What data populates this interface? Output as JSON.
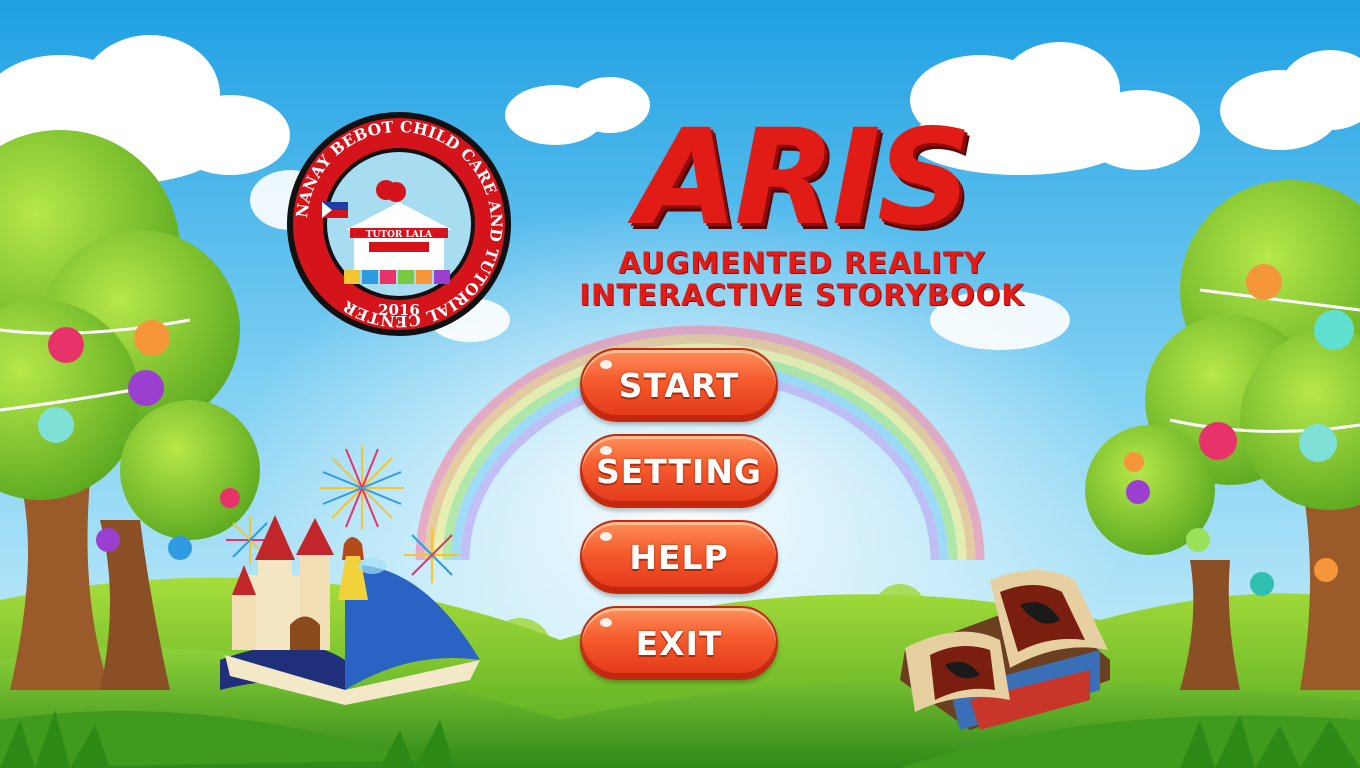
{
  "logo": {
    "ring_text": "NANAY BEBOT CHILD CARE AND TUTORIAL CENTER",
    "year": "2016",
    "banner_text": "TUTOR LALA"
  },
  "title": {
    "main": "ARIS",
    "line1": "AUGMENTED REALITY",
    "line2": "INTERACTIVE STORYBOOK"
  },
  "menu": {
    "start": "START",
    "setting": "SETTING",
    "help": "HELP",
    "exit": "EXIT"
  },
  "colors": {
    "title_red": "#e11c17",
    "button_orange": "#f45a2c",
    "sky_top": "#2aa6e6",
    "grass": "#6cc12b"
  }
}
